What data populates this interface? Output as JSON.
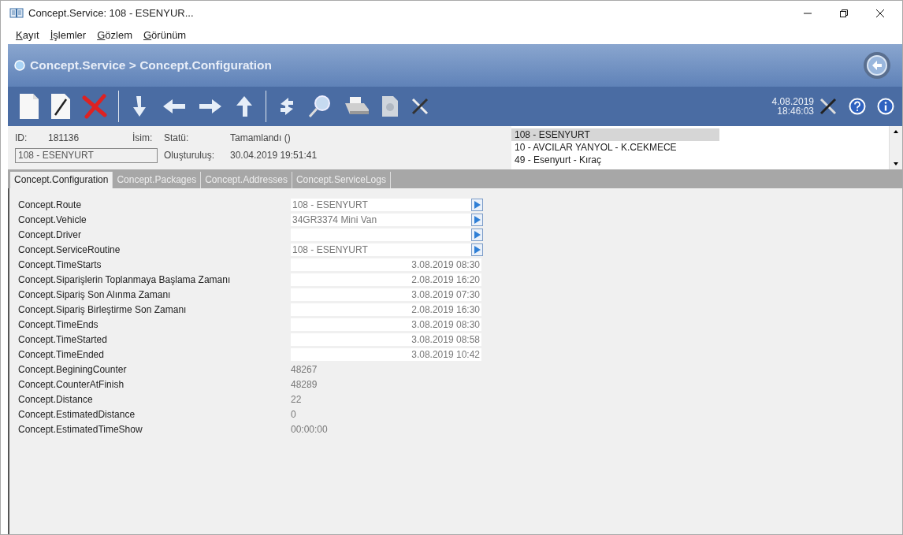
{
  "window": {
    "title": "Concept.Service: 108 - ESENYUR..."
  },
  "menu": [
    "Kayıt",
    "İşlemler",
    "Gözlem",
    "Görünüm"
  ],
  "breadcrumb": "Concept.Service > Concept.Configuration",
  "clock": {
    "date": "4.08.2019",
    "time": "18:46:03"
  },
  "header": {
    "id_label": "ID:",
    "id": "181136",
    "name_label": "İsim:",
    "name_value": "108 - ESENYURT",
    "status_label": "Statü:",
    "status": "Tamamlandı ()",
    "created_label": "Oluşturuluş:",
    "created": "30.04.2019 19:51:41"
  },
  "routes": [
    {
      "label": "108 - ESENYURT",
      "selected": true
    },
    {
      "label": "10 - AVCILAR YANYOL - K.CEKMECE",
      "selected": false
    },
    {
      "label": "49 - Esenyurt - Kıraç",
      "selected": false
    }
  ],
  "tabs": [
    {
      "label": "Concept.Configuration",
      "selected": true
    },
    {
      "label": "Concept.Packages",
      "selected": false
    },
    {
      "label": "Concept.Addresses",
      "selected": false
    },
    {
      "label": "Concept.ServiceLogs",
      "selected": false
    }
  ],
  "fields": [
    {
      "kind": "lookup",
      "label": "Concept.Route",
      "value": "108 - ESENYURT"
    },
    {
      "kind": "lookup",
      "label": "Concept.Vehicle",
      "value": "34GR3374 Mini Van"
    },
    {
      "kind": "lookup",
      "label": "Concept.Driver"
    },
    {
      "kind": "lookup",
      "label": "Concept.ServiceRoutine",
      "value": "108 - ESENYURT"
    },
    {
      "kind": "datetime",
      "label": "Concept.TimeStarts",
      "value": "3.08.2019 08:30"
    },
    {
      "kind": "datetime",
      "label": "Concept.Siparişlerin Toplanmaya Başlama Zamanı",
      "value": "2.08.2019 16:20"
    },
    {
      "kind": "datetime",
      "label": "Concept.Sipariş Son Alınma Zamanı",
      "value": "3.08.2019 07:30"
    },
    {
      "kind": "datetime",
      "label": "Concept.Sipariş Birleştirme Son Zamanı",
      "value": "2.08.2019 16:30"
    },
    {
      "kind": "datetime",
      "label": "Concept.TimeEnds",
      "value": "3.08.2019 08:30"
    },
    {
      "kind": "datetime",
      "label": "Concept.TimeStarted",
      "value": "3.08.2019 08:58"
    },
    {
      "kind": "datetime",
      "label": "Concept.TimeEnded",
      "value": "3.08.2019 10:42"
    },
    {
      "kind": "plain",
      "label": "Concept.BeginingCounter",
      "value": "48267"
    },
    {
      "kind": "plain",
      "label": "Concept.CounterAtFinish",
      "value": "48289"
    },
    {
      "kind": "plain",
      "label": "Concept.Distance",
      "value": "22"
    },
    {
      "kind": "plain",
      "label": "Concept.EstimatedDistance",
      "value": "0"
    },
    {
      "kind": "plain",
      "label": "Concept.EstimatedTimeShow",
      "value": "00:00:00"
    }
  ]
}
